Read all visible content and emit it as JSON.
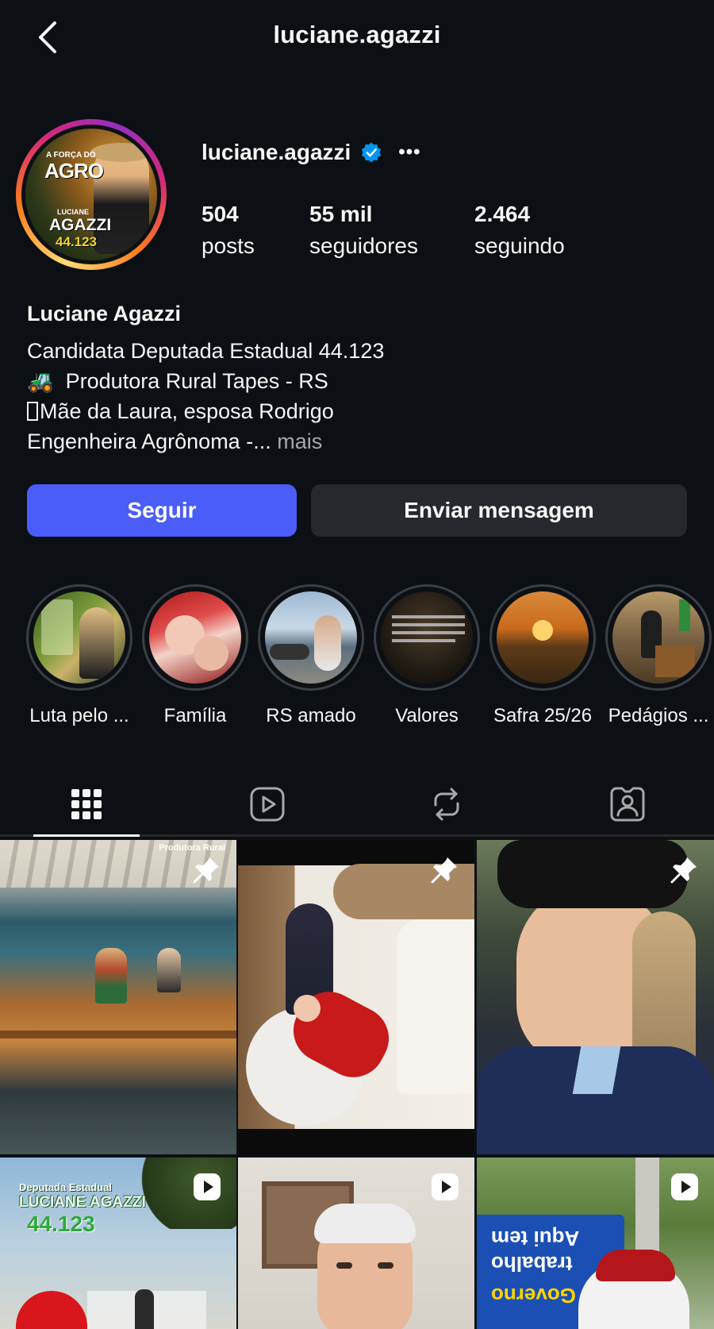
{
  "header": {
    "title": "luciane.agazzi"
  },
  "profile": {
    "username": "luciane.agazzi",
    "more_label": "•••",
    "avatar_text": {
      "line1": "A FORÇA DO",
      "line2": "AGRO",
      "name1": "LUCIANE",
      "name2": "AGAZZI",
      "number": "44.123"
    },
    "stats": [
      {
        "value": "504",
        "label": "posts"
      },
      {
        "value": "55 mil",
        "label": "seguidores"
      },
      {
        "value": "2.464",
        "label": "seguindo"
      }
    ],
    "full_name": "Luciane Agazzi",
    "bio": {
      "line1": "Candidata Deputada Estadual 44.123",
      "line2_emoji": "🚜",
      "line2": "Produtora Rural Tapes - RS",
      "line3": "Mãe da Laura, esposa Rodrigo",
      "line4": "Engenheira Agrônoma -...",
      "more": "mais"
    }
  },
  "actions": {
    "follow": "Seguir",
    "message": "Enviar mensagem"
  },
  "highlights": [
    {
      "label": "Luta pelo ..."
    },
    {
      "label": "Família "
    },
    {
      "label": "RS amado"
    },
    {
      "label": "Valores"
    },
    {
      "label": "Safra 25/26"
    },
    {
      "label": "Pedágios ..."
    }
  ],
  "tabs": [
    "grid-icon",
    "reels-icon",
    "reposts-icon",
    "tagged-icon"
  ],
  "posts": [
    {
      "type": "pinned",
      "caption": "Produtora Rural"
    },
    {
      "type": "pinned",
      "caption": ""
    },
    {
      "type": "pinned",
      "caption": ""
    },
    {
      "type": "reel",
      "caption": "Deputada Estadual",
      "caption2": "LUCIANE AGAZZI",
      "caption3": "44.123"
    },
    {
      "type": "reel",
      "caption": ""
    },
    {
      "type": "reel",
      "caption": "Aqui tem",
      "caption2": "trabalho",
      "caption3": "Governo"
    }
  ],
  "colors": {
    "background": "#0c1014",
    "follow_button": "#4a5df9",
    "secondary_button": "#25292e",
    "verified": "#0095f6"
  }
}
